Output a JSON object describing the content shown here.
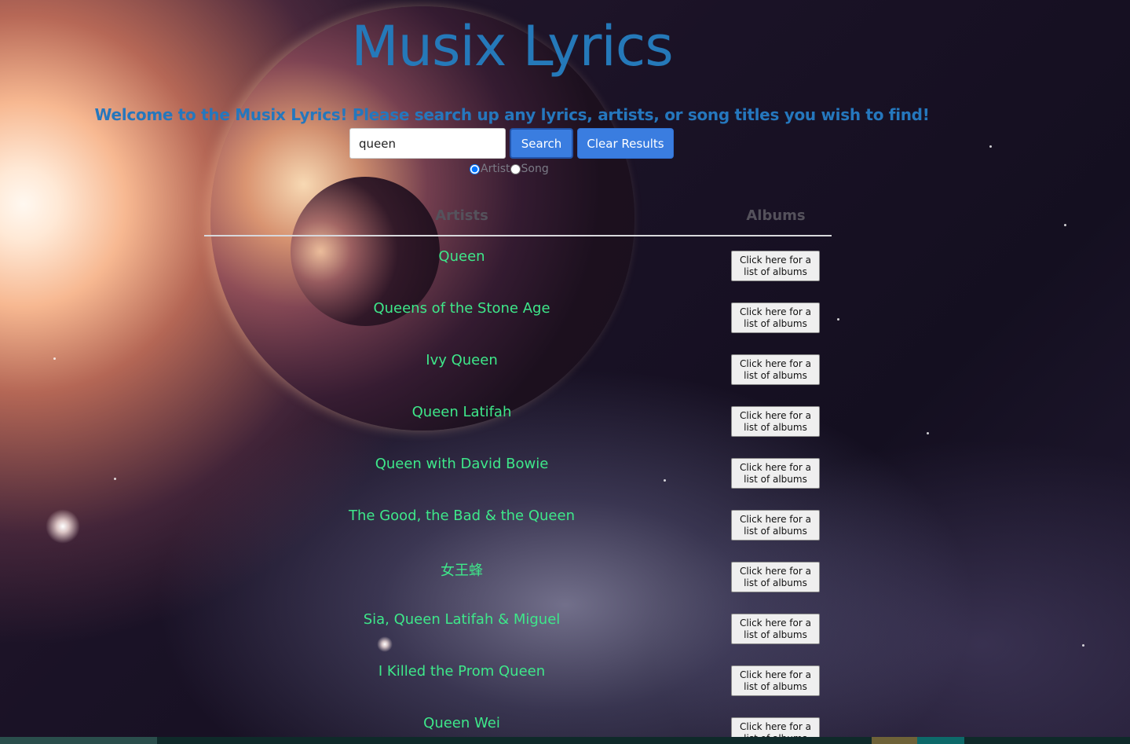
{
  "header": {
    "title": "Musix Lyrics",
    "welcome": "Welcome to the Musix Lyrics! Please search up any lyrics, artists, or song titles you wish to find!"
  },
  "search": {
    "value": "queen",
    "search_label": "Search",
    "clear_label": "Clear Results",
    "mode_artist_label": "Artist",
    "mode_song_label": "Song",
    "selected_mode": "Artist"
  },
  "table": {
    "headers": [
      "Artists",
      "Albums"
    ],
    "album_button_label": "Click here for a list of albums",
    "rows": [
      {
        "artist": "Queen"
      },
      {
        "artist": "Queens of the Stone Age"
      },
      {
        "artist": "Ivy Queen"
      },
      {
        "artist": "Queen Latifah"
      },
      {
        "artist": "Queen with David Bowie"
      },
      {
        "artist": "The Good, the Bad & the Queen"
      },
      {
        "artist": "女王蜂"
      },
      {
        "artist": "Sia, Queen Latifah & Miguel"
      },
      {
        "artist": "I Killed the Prom Queen"
      },
      {
        "artist": "Queen Wei"
      }
    ]
  },
  "colors": {
    "title": "#2579b9",
    "artist_text": "#3ee88a",
    "button_blue": "#3a7de0",
    "header_text": "#55525c"
  }
}
